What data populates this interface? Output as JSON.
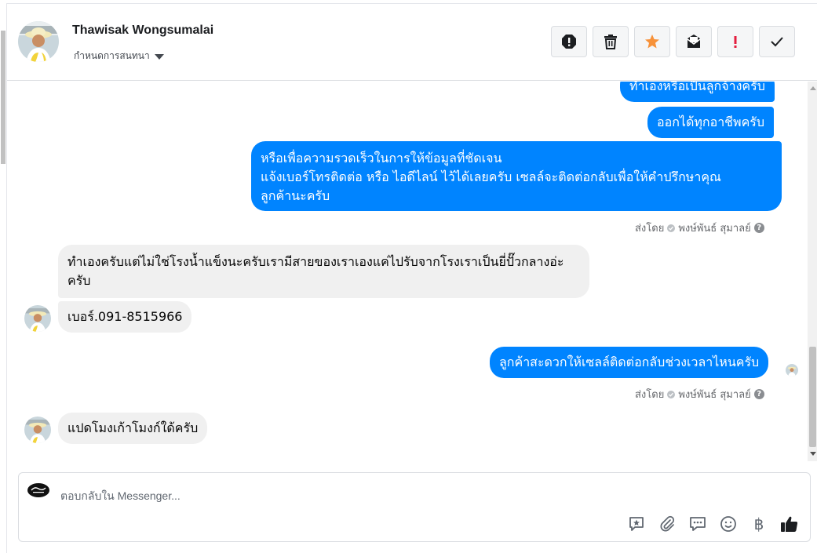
{
  "header": {
    "contact_name": "Thawisak Wongsumalai",
    "assign_label": "กำหนดการสนทนา"
  },
  "toolbar": {
    "items": [
      {
        "icon": "report-icon"
      },
      {
        "icon": "trash-icon"
      },
      {
        "icon": "star-icon"
      },
      {
        "icon": "mark-unread-icon"
      },
      {
        "icon": "follow-up-icon"
      },
      {
        "icon": "done-check-icon"
      }
    ],
    "star_color": "#f7923a",
    "follow_up_color": "#e41e3f"
  },
  "messages": {
    "m1": "ทำเองหรือเป็นลูกจ้างครับ",
    "m2": "ออกได้ทุกอาชีพครับ",
    "m3_line1": "หรือเพื่อความรวดเร็วในการให้ข้อมูลที่ชัดเจน",
    "m3_line2": "แจ้งเบอร์โทรติดต่อ หรือ ไอดีไลน์ ไว้ได้เลยครับ เซลล์จะติดต่อกลับเพื่อให้คำปรึกษาคุณ",
    "m3_line3": "ลูกค้านะครับ",
    "sent_by_1": "ส่งโดย",
    "sender_1": "พงษ์พันธ์ สุมาลย์",
    "m4_line1": "ทำเองครับแต่ไม่ใช่โรงน้ำแข็งนะครับเรามีสายของเราเองแค่ไปรับจากโรงเราเป็นยี่ปั๊วกลางอ่ะ",
    "m4_line2": "ครับ",
    "m5": "เบอร์.091-8515966",
    "m6": "ลูกค้าสะดวกให้เซลล์ติดต่อกลับช่วงเวลาไหนครับ",
    "sent_by_2": "ส่งโดย",
    "sender_2": "พงษ์พันธ์ สุมาลย์",
    "m7": "แปดโมงเก้าโมงก์ใด้ครับ"
  },
  "composer": {
    "placeholder": "ตอบกลับใน Messenger...",
    "icons": [
      "saved-reply-icon",
      "attachment-icon",
      "comment-icon",
      "emoji-icon",
      "baht-icon",
      "like-icon"
    ],
    "baht_symbol": "฿"
  },
  "colors": {
    "outgoing_bubble": "#0084ff",
    "incoming_bubble": "#f0f0f0"
  }
}
